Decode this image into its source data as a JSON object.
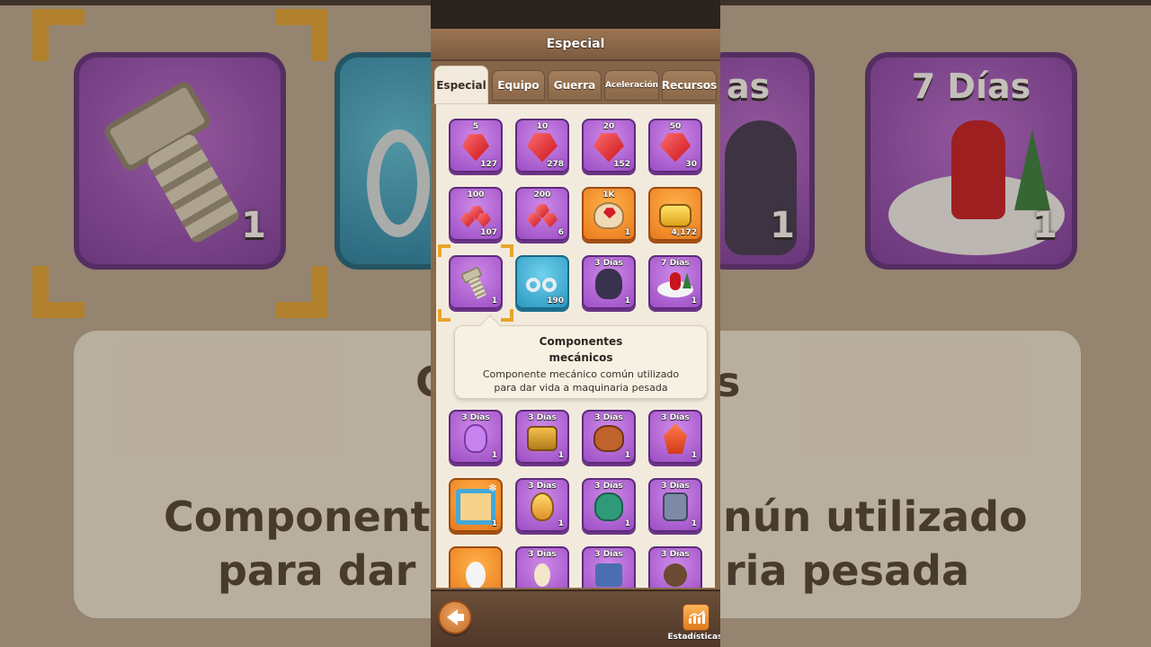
{
  "window": {
    "title": "Especial"
  },
  "tabs": [
    {
      "label": "Especial",
      "active": true
    },
    {
      "label": "Equipo",
      "active": false
    },
    {
      "label": "Guerra",
      "active": false
    },
    {
      "label": "Aceleración",
      "active": false
    },
    {
      "label": "Recursos",
      "active": false
    }
  ],
  "items": [
    {
      "name": "gem-5",
      "top": "5",
      "count": "127",
      "style": "purple",
      "icon": "gem-icon"
    },
    {
      "name": "gem-10",
      "top": "10",
      "count": "278",
      "style": "purple",
      "icon": "gem-icon"
    },
    {
      "name": "gem-20",
      "top": "20",
      "count": "152",
      "style": "purple",
      "icon": "gem-icon"
    },
    {
      "name": "gem-50",
      "top": "50",
      "count": "30",
      "style": "purple",
      "icon": "gem-icon"
    },
    {
      "name": "gem-100",
      "top": "100",
      "count": "107",
      "style": "purple",
      "icon": "gem-pile-icon"
    },
    {
      "name": "gem-200",
      "top": "200",
      "count": "6",
      "style": "purple",
      "icon": "gem-pile-icon"
    },
    {
      "name": "gem-1k",
      "top": "1K",
      "count": "1",
      "style": "orange",
      "icon": "gem-sack-icon"
    },
    {
      "name": "resource-magic",
      "top": "",
      "count": "4,172",
      "style": "orange",
      "icon": "gold-canister-icon"
    },
    {
      "name": "mechanical-parts",
      "top": "",
      "count": "1",
      "style": "purple",
      "icon": "bolt-icon",
      "selected": true
    },
    {
      "name": "handcuffs",
      "top": "",
      "count": "190",
      "style": "blue",
      "icon": "handcuffs-icon"
    },
    {
      "name": "decoration-3d-a",
      "top": "3 Días",
      "count": "1",
      "style": "purple",
      "icon": "statue-icon"
    },
    {
      "name": "decoration-7d",
      "top": "7 Días",
      "count": "1",
      "style": "purple",
      "icon": "santa-icon"
    }
  ],
  "tooltip": {
    "title_line1": "Componentes",
    "title_line2": "mecánicos",
    "desc_line1": "Componente mecánico común utilizado",
    "desc_line2": "para dar vida a maquinaria pesada"
  },
  "items_lower": [
    {
      "name": "decoration-b",
      "top": "3 Días",
      "count": "1",
      "style": "purple",
      "icon": "potion-icon"
    },
    {
      "name": "decoration-c",
      "top": "3 Días",
      "count": "1",
      "style": "purple",
      "icon": "chest-icon"
    },
    {
      "name": "decoration-d",
      "top": "3 Días",
      "count": "1",
      "style": "purple",
      "icon": "cannon-icon"
    },
    {
      "name": "decoration-e",
      "top": "3 Días",
      "count": "1",
      "style": "purple",
      "icon": "crystal-icon"
    },
    {
      "name": "scenery-frame",
      "top": "",
      "count": "1",
      "style": "orange",
      "icon": "snowflake-frame-icon"
    },
    {
      "name": "decoration-f",
      "top": "3 Días",
      "count": "1",
      "style": "purple",
      "icon": "egg-icon"
    },
    {
      "name": "decoration-g",
      "top": "3 Días",
      "count": "1",
      "style": "purple",
      "icon": "hero-icon"
    },
    {
      "name": "decoration-h",
      "top": "3 Días",
      "count": "1",
      "style": "purple",
      "icon": "robot-icon"
    },
    {
      "name": "decoration-i",
      "top": "",
      "count": "",
      "style": "orange",
      "icon": "snowman-icon"
    },
    {
      "name": "decoration-j",
      "top": "3 Días",
      "count": "",
      "style": "purple",
      "icon": "wizard-icon"
    },
    {
      "name": "decoration-k",
      "top": "3 Días",
      "count": "",
      "style": "purple",
      "icon": "tower-icon"
    },
    {
      "name": "decoration-l",
      "top": "3 Días",
      "count": "",
      "style": "purple",
      "icon": "skull-icon"
    }
  ],
  "footer": {
    "stats_label": "Estadísticas"
  },
  "background": {
    "days_label": "7 Días",
    "count_left": "1",
    "count_mid": "1",
    "count_right": "1",
    "line1": "Componente",
    "line1_right": "nún utilizado",
    "line2": "para dar vi",
    "line2_right": "ria pesada",
    "mid_fragment": "as",
    "s_fragment": "s",
    "c_fragment": "C"
  },
  "colors": {
    "accent": "#e8a52a",
    "purple_item": "#9b4dc4",
    "orange_item": "#e8791c",
    "blue_item": "#2a97c0",
    "panel": "#f2ebdd"
  }
}
